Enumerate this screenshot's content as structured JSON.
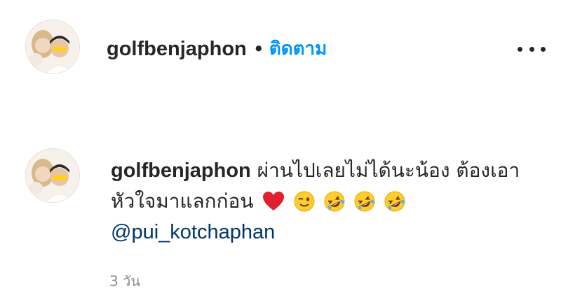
{
  "header": {
    "username": "golfbenjaphon",
    "separator": "•",
    "follow_label": "ติดตาม",
    "more_icon": "more-horizontal-icon"
  },
  "comment": {
    "username": "golfbenjaphon",
    "text": "ผ่านไปเลยไม่ได้นะน้อง ต้องเอาหัวใจมาแลกก่อน",
    "emojis": [
      "red-heart-icon",
      "winking-face-icon",
      "rolling-on-floor-laughing-icon",
      "rolling-on-floor-laughing-icon",
      "rolling-on-floor-laughing-icon"
    ],
    "mention": "@pui_kotchaphan",
    "timestamp": "3 วัน"
  },
  "colors": {
    "link": "#0095f6",
    "mention": "#00376b",
    "text": "#262626",
    "muted": "#8e8e8e"
  }
}
